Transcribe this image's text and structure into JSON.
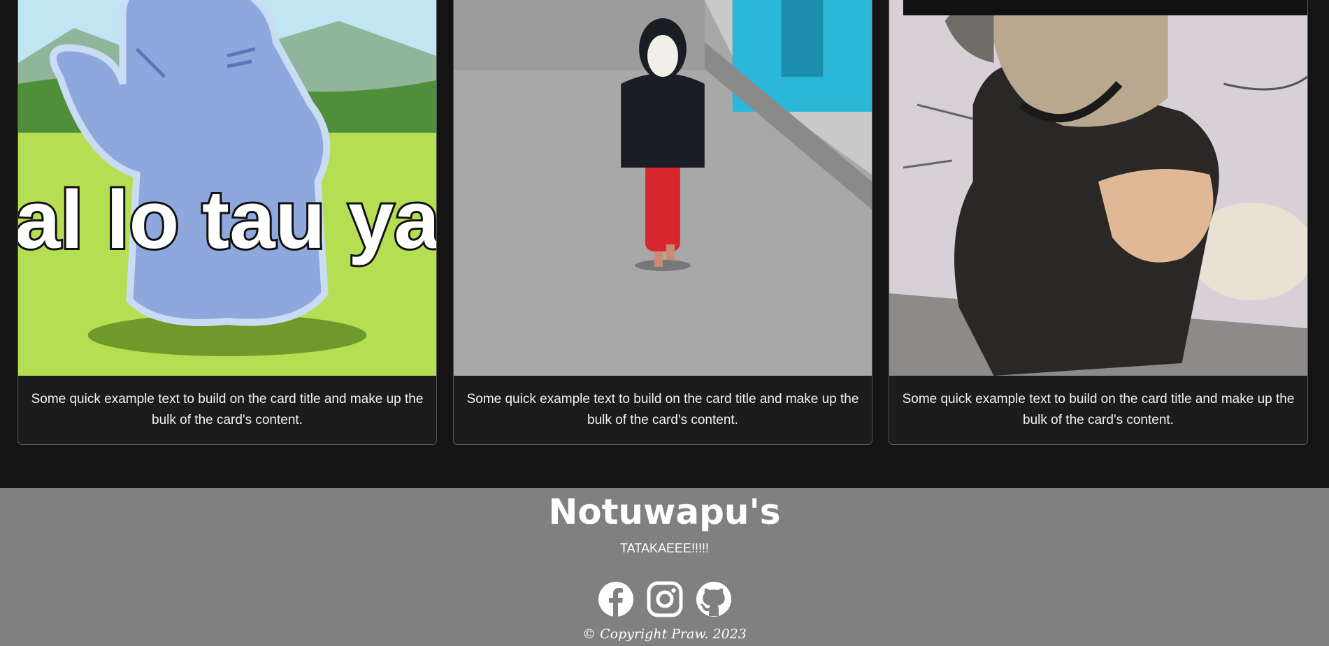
{
  "cards": [
    {
      "image_alt": "meme-ghost",
      "image_caption": "al lo tau ya",
      "text": "Some quick example text to build on the card title and make up the bulk of the card's content."
    },
    {
      "image_alt": "meme-masked-kid",
      "text": "Some quick example text to build on the card title and make up the bulk of the card's content."
    },
    {
      "image_alt": "meme-masked-man",
      "text": "Some quick example text to build on the card title and make up the bulk of the card's content."
    }
  ],
  "footer": {
    "brand": "Notuwapu's",
    "tagline": "TATAKAEEE!!!!!",
    "socials": [
      {
        "icon": "facebook-icon"
      },
      {
        "icon": "instagram-icon"
      },
      {
        "icon": "github-icon"
      }
    ],
    "copyright": "Copyright Praw. 2023"
  },
  "colors": {
    "page_bg": "#141414",
    "card_bg": "#1c1c1c",
    "footer_bg": "#808080",
    "text": "#ffffff"
  }
}
